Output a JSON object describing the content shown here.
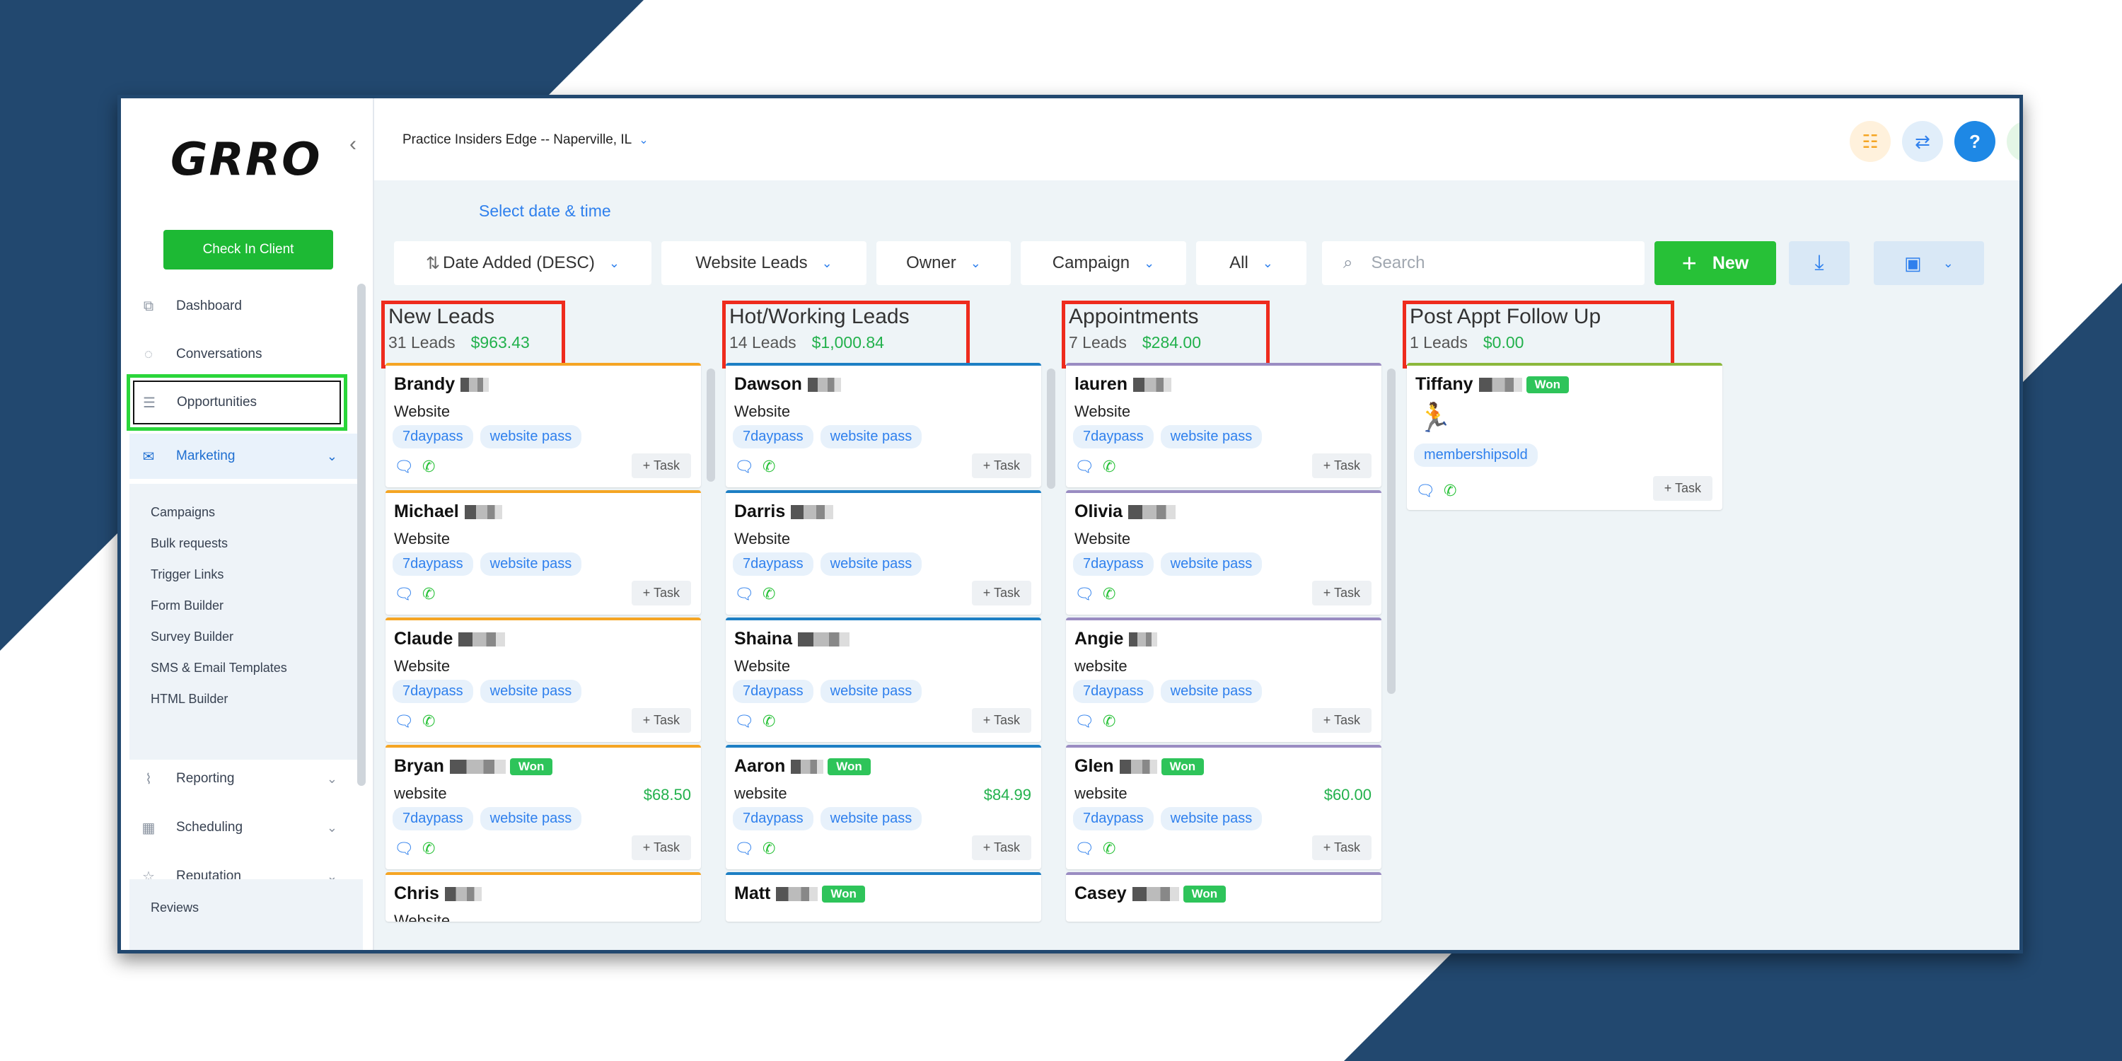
{
  "window": {
    "brand_logo": "GRRO",
    "collapse_icon": "chevron-left-icon",
    "checkin_label": "Check In Client"
  },
  "sidebar": {
    "items": [
      {
        "label": "Dashboard",
        "icon": "dashboard-icon"
      },
      {
        "label": "Conversations",
        "icon": "chat-icon"
      },
      {
        "label": "Opportunities",
        "icon": "opportunities-icon"
      },
      {
        "label": "Marketing",
        "icon": "mail-icon"
      },
      {
        "label": "Reporting",
        "icon": "chart-icon"
      },
      {
        "label": "Scheduling",
        "icon": "calendar-icon"
      },
      {
        "label": "Reputation",
        "icon": "star-icon"
      }
    ],
    "submenu": [
      "Campaigns",
      "Bulk requests",
      "Trigger Links",
      "Form Builder",
      "Survey Builder",
      "SMS & Email Templates",
      "HTML Builder"
    ],
    "reviews": "Reviews"
  },
  "topbar": {
    "location": "Practice Insiders Edge -- Naperville, IL"
  },
  "toolbar": {
    "date_select": "Select date & time",
    "sort": "Date Added (DESC)",
    "pipeline": "Website Leads",
    "owner": "Owner",
    "campaign": "Campaign",
    "status": "All",
    "search_placeholder": "Search",
    "new_label": "New"
  },
  "columns": [
    {
      "title": "New Leads",
      "count": "31 Leads",
      "amount": "$963.43",
      "color": "#f5a524",
      "cards": [
        {
          "name": "Brandy",
          "source": "Website",
          "won": false,
          "price": ""
        },
        {
          "name": "Michael",
          "source": "Website",
          "won": false,
          "price": ""
        },
        {
          "name": "Claude",
          "source": "Website",
          "won": false,
          "price": ""
        },
        {
          "name": "Bryan",
          "source": "website",
          "won": true,
          "price": "$68.50"
        },
        {
          "name": "Chris",
          "source": "Website",
          "won": false,
          "price": ""
        }
      ]
    },
    {
      "title": "Hot/Working Leads",
      "count": "14 Leads",
      "amount": "$1,000.84",
      "color": "#1d7fc4",
      "cards": [
        {
          "name": "Dawson",
          "source": "Website",
          "won": false,
          "price": ""
        },
        {
          "name": "Darris",
          "source": "Website",
          "won": false,
          "price": ""
        },
        {
          "name": "Shaina",
          "source": "Website",
          "won": false,
          "price": ""
        },
        {
          "name": "Aaron",
          "source": "website",
          "won": true,
          "price": "$84.99"
        },
        {
          "name": "Matt",
          "source": "",
          "won": true,
          "price": ""
        }
      ]
    },
    {
      "title": "Appointments",
      "count": "7 Leads",
      "amount": "$284.00",
      "color": "#9a8cc2",
      "cards": [
        {
          "name": "lauren",
          "source": "Website",
          "won": false,
          "price": ""
        },
        {
          "name": "Olivia",
          "source": "Website",
          "won": false,
          "price": ""
        },
        {
          "name": "Angie",
          "source": "website",
          "won": false,
          "price": ""
        },
        {
          "name": "Glen",
          "source": "website",
          "won": true,
          "price": "$60.00"
        },
        {
          "name": "Casey",
          "source": "",
          "won": true,
          "price": ""
        }
      ]
    },
    {
      "title": "Post Appt Follow Up",
      "count": "1 Leads",
      "amount": "$0.00",
      "color": "#8cb83c",
      "cards": [
        {
          "name": "Tiffany",
          "source": "",
          "won": true,
          "price": "",
          "tag": "membershipsold"
        }
      ]
    }
  ],
  "tags": {
    "t1": "7daypass",
    "t2": "website pass"
  },
  "labels": {
    "won": "Won",
    "task": "+ Task"
  }
}
